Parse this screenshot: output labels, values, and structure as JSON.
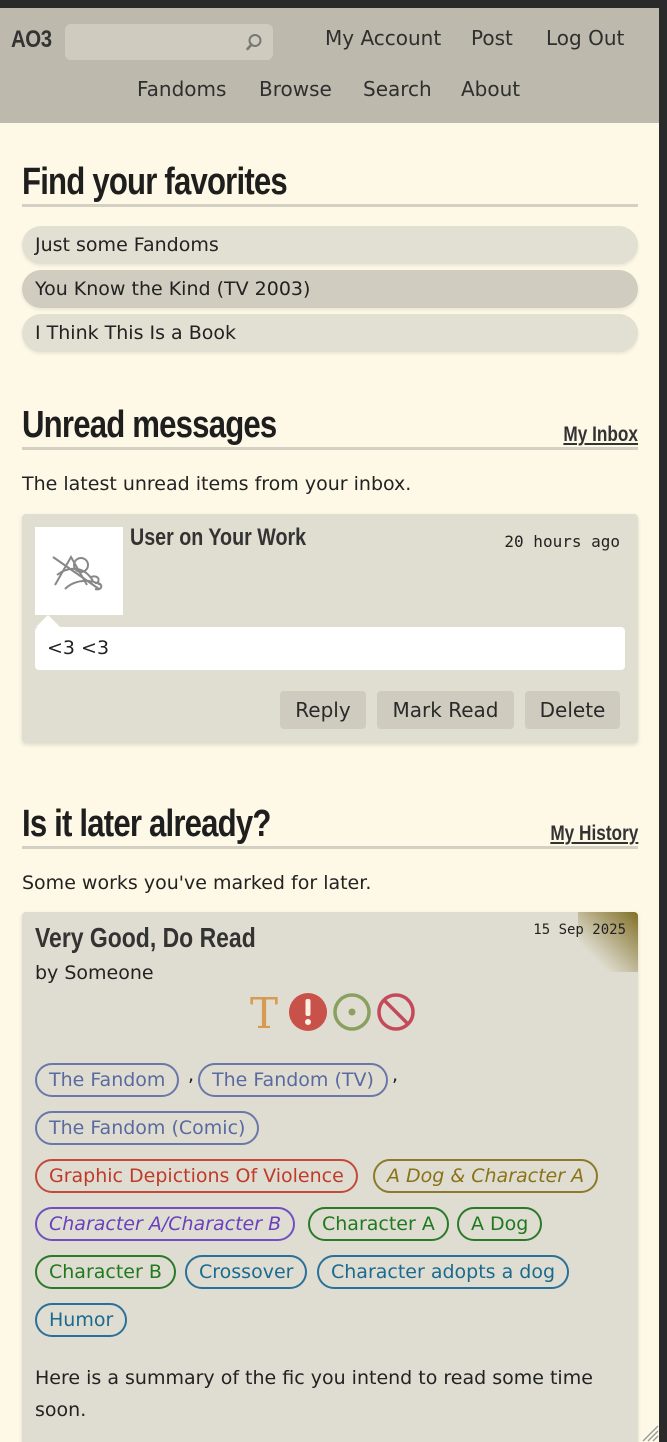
{
  "header": {
    "logo": "AO3",
    "search_placeholder": "",
    "top_links": [
      "My Account",
      "Post",
      "Log Out"
    ],
    "nav_links": [
      "Fandoms",
      "Browse",
      "Search",
      "About"
    ]
  },
  "favorites": {
    "heading": "Find your favorites",
    "items": [
      "Just some Fandoms",
      "You Know the Kind (TV 2003)",
      "I Think This Is a Book"
    ]
  },
  "messages": {
    "heading": "Unread messages",
    "link": "My Inbox",
    "description": "The latest unread items from your inbox.",
    "item": {
      "title": "User on Your Work",
      "time": "20 hours ago",
      "body": "<3 <3",
      "buttons": [
        "Reply",
        "Mark Read",
        "Delete"
      ]
    }
  },
  "later": {
    "heading": "Is it later already?",
    "link": "My History",
    "description": "Some works you've marked for later.",
    "work": {
      "title": "Very Good, Do Read",
      "date": "15 Sep 2025",
      "by": "by",
      "author": "Someone",
      "rating_symbol": "T",
      "fandoms": [
        "The Fandom",
        "The Fandom (TV)",
        "The Fandom (Comic)"
      ],
      "warnings": [
        "Graphic Depictions Of Violence"
      ],
      "relationships": [
        "A Dog & Character A",
        "Character A/Character B"
      ],
      "characters": [
        "Character A",
        "A Dog",
        "Character B"
      ],
      "freeforms": [
        "Crossover",
        "Character adopts a dog",
        "Humor"
      ],
      "summary": "Here is a summary of the fic you intend to read some time soon.",
      "colors": {
        "rating": "#d89a50",
        "warning": "#c8524a",
        "complete": "#8aa060",
        "category": "#c24a5a"
      }
    }
  }
}
